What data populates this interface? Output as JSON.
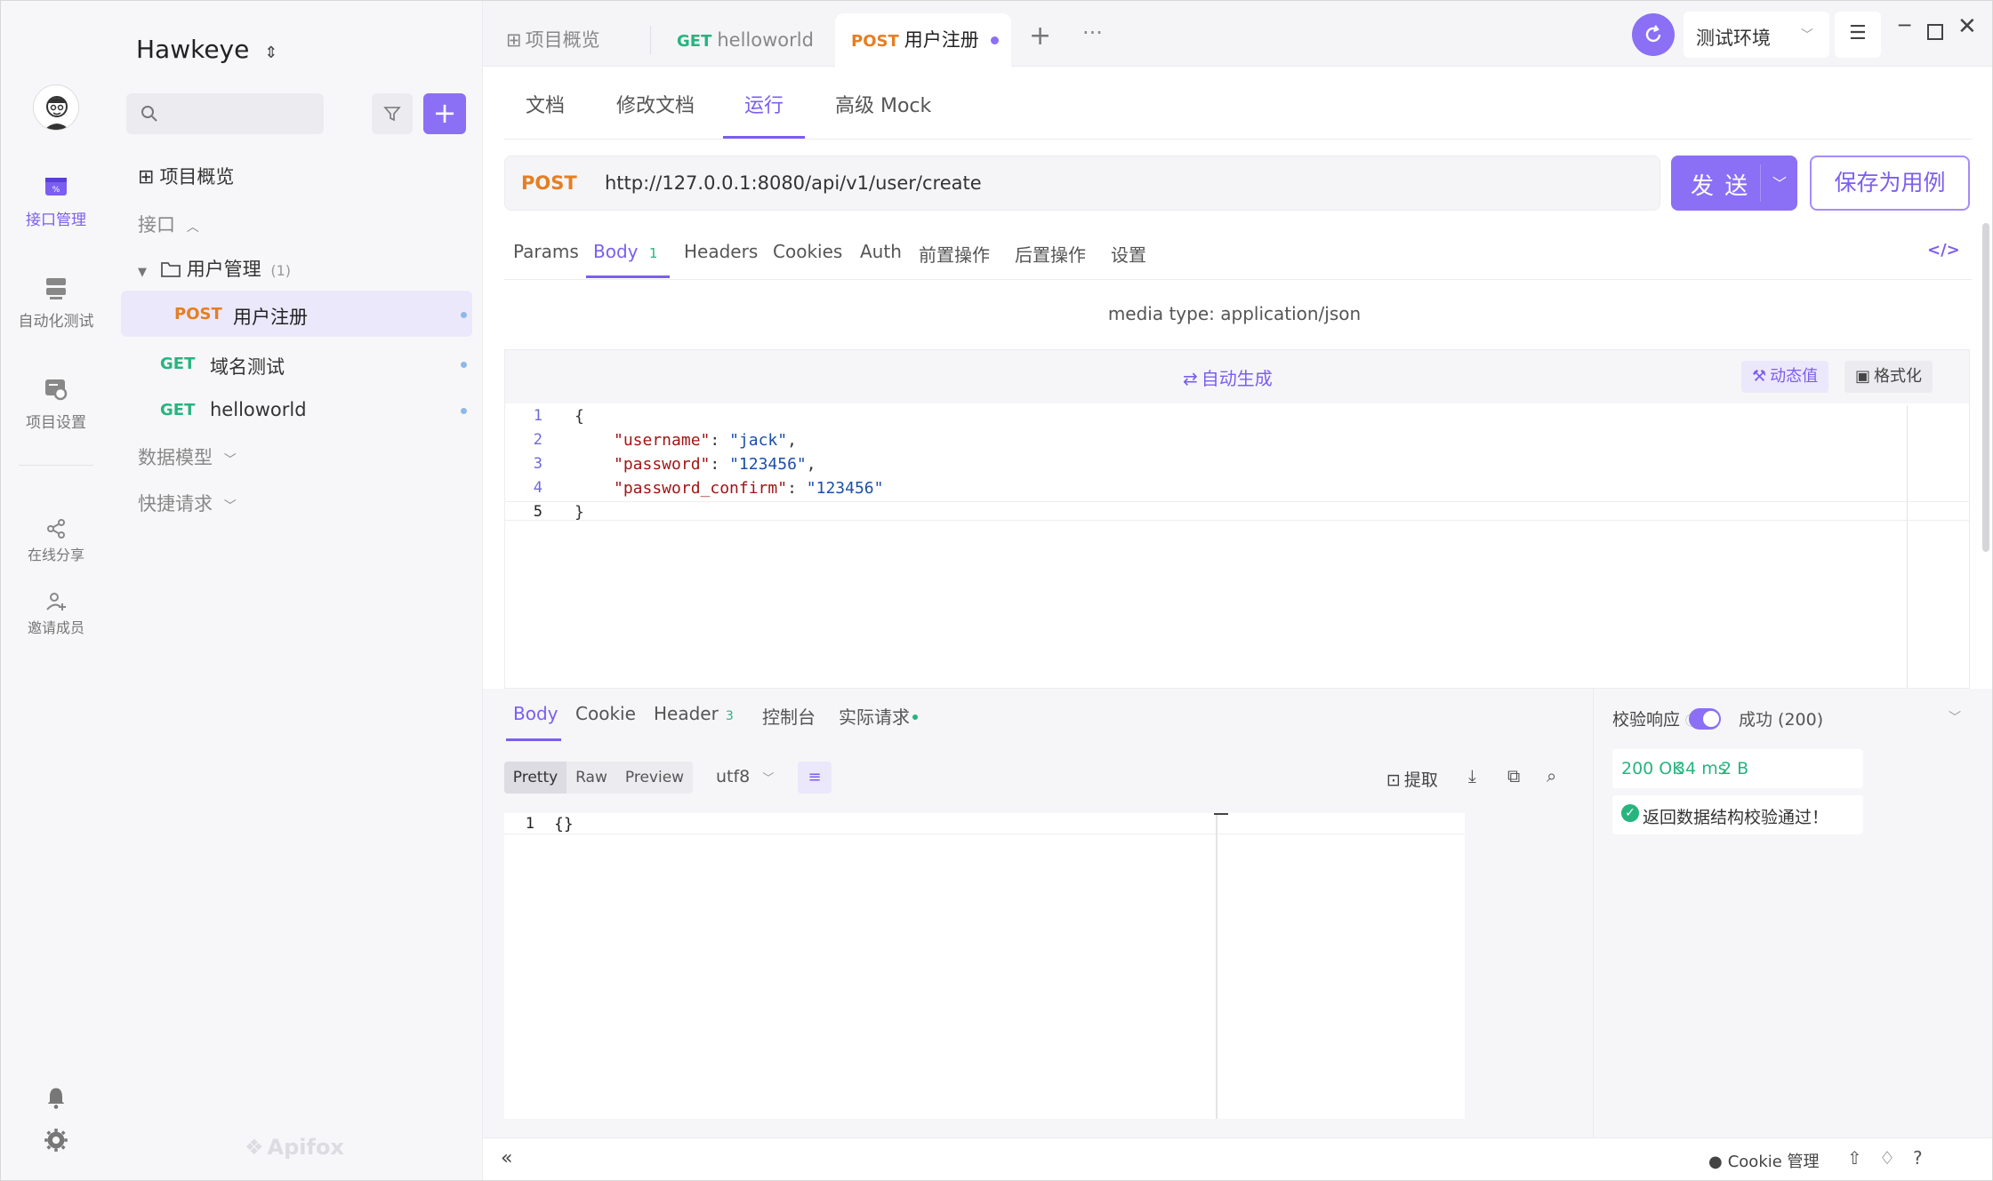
{
  "workspace": {
    "name": "Hawkeye",
    "switch_icon": "chevron-updown-icon"
  },
  "rail": {
    "items": [
      {
        "label": "接口管理",
        "icon": "api-icon",
        "active": true
      },
      {
        "label": "自动化测试",
        "icon": "automation-icon"
      },
      {
        "label": "项目设置",
        "icon": "settings-box-icon"
      },
      {
        "label": "在线分享",
        "icon": "share-icon"
      },
      {
        "label": "邀请成员",
        "icon": "invite-user-icon"
      }
    ]
  },
  "sidebar": {
    "search_placeholder": "",
    "overview": "项目概览",
    "section_api": "接口",
    "folder": {
      "name": "用户管理",
      "count": "(1)"
    },
    "items": [
      {
        "method": "POST",
        "name": "用户注册",
        "active": true
      },
      {
        "method": "GET",
        "name": "域名测试"
      },
      {
        "method": "GET",
        "name": "helloworld"
      }
    ],
    "section_models": "数据模型",
    "section_quick": "快捷请求",
    "brand": "Apifox"
  },
  "top_tabs": [
    {
      "label": "项目概览",
      "icon": "grid-icon"
    },
    {
      "method": "GET",
      "label": "helloworld"
    },
    {
      "method": "POST",
      "label": "用户注册",
      "active": true
    }
  ],
  "env": {
    "label": "测试环境"
  },
  "sub_tabs": [
    "文档",
    "修改文档",
    "运行",
    "高级 Mock"
  ],
  "sub_tab_active": "运行",
  "request": {
    "method": "POST",
    "url": "http://127.0.0.1:8080/api/v1/user/create",
    "send": "发 送",
    "save": "保存为用例"
  },
  "req_tabs": {
    "params": "Params",
    "body": "Body",
    "body_count": "1",
    "headers": "Headers",
    "cookies": "Cookies",
    "auth": "Auth",
    "pre": "前置操作",
    "post": "后置操作",
    "settings": "设置"
  },
  "media_type": "media type: application/json",
  "editor": {
    "auto_gen": "自动生成",
    "dynamic": "动态值",
    "format": "格式化",
    "lines": [
      {
        "n": "1",
        "text": "{"
      },
      {
        "n": "2",
        "key": "\"username\"",
        "val": "\"jack\"",
        "comma": ","
      },
      {
        "n": "3",
        "key": "\"password\"",
        "val": "\"123456\"",
        "comma": ","
      },
      {
        "n": "4",
        "key": "\"password_confirm\"",
        "val": "\"123456\"",
        "comma": ""
      },
      {
        "n": "5",
        "text": "}"
      }
    ]
  },
  "resp_tabs": {
    "body": "Body",
    "cookie": "Cookie",
    "header": "Header",
    "header_count": "3",
    "console": "控制台",
    "actual": "实际请求"
  },
  "resp_view": {
    "pretty": "Pretty",
    "raw": "Raw",
    "preview": "Preview",
    "encoding": "utf8",
    "extract": "提取",
    "line_no": "1",
    "content": "{}"
  },
  "validation": {
    "label": "校验响应",
    "status": "成功 (200)",
    "code": "200 OK",
    "time": "34 ms",
    "size": "2 B",
    "message": "返回数据结构校验通过！"
  },
  "footer": {
    "cookie": "Cookie 管理"
  },
  "colors": {
    "accent": "#7b5ef0",
    "post": "#e67e22",
    "get": "#27b47f"
  }
}
